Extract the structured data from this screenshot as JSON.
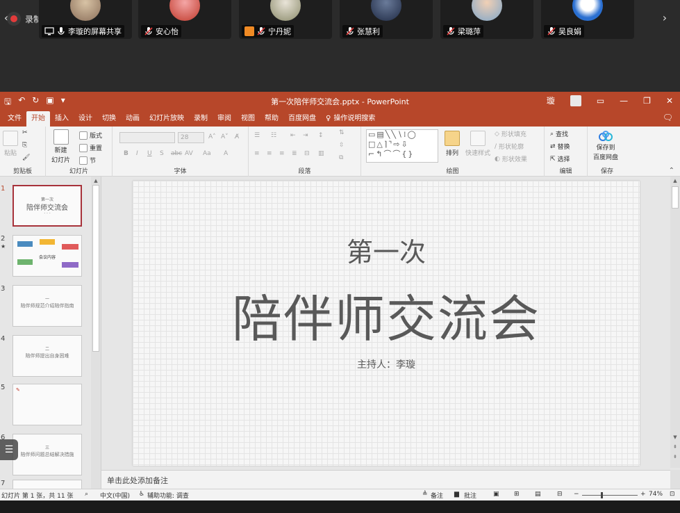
{
  "meeting": {
    "recording_label": "录制中",
    "participants": [
      {
        "name": "李璇的屏幕共享"
      },
      {
        "name": "安心怡"
      },
      {
        "name": "宁丹妮"
      },
      {
        "name": "张慧利"
      },
      {
        "name": "梁璐萍"
      },
      {
        "name": "吴良娟"
      }
    ]
  },
  "ppt": {
    "document_title": "第一次陪伴师交流会.pptx  -  PowerPoint",
    "user_initial": "璇",
    "tabs": [
      "文件",
      "开始",
      "插入",
      "设计",
      "切换",
      "动画",
      "幻灯片放映",
      "录制",
      "审阅",
      "视图",
      "帮助",
      "百度网盘"
    ],
    "active_tab": "开始",
    "tell_me": "操作说明搜索",
    "ribbon": {
      "clipboard": {
        "label": "剪贴板",
        "paste": "粘贴"
      },
      "slides": {
        "label": "幻灯片",
        "new_slide": "新建",
        "new_slide2": "幻灯片",
        "layout": "版式",
        "reset": "重置",
        "section": "节"
      },
      "font": {
        "label": "字体",
        "font_size": "28",
        "bold": "B",
        "italic": "I",
        "underline": "U",
        "strike": "S",
        "abc": "abc",
        "av": "AV",
        "aa": "Aa",
        "a_color": "A"
      },
      "paragraph": {
        "label": "段落"
      },
      "drawing": {
        "label": "绘图",
        "arrange": "排列",
        "quick_styles": "快速样式",
        "shape_fill": "形状填充",
        "shape_outline": "形状轮廓",
        "shape_effects": "形状效果"
      },
      "editing": {
        "label": "编辑",
        "find": "查找",
        "replace": "替换",
        "select": "选择"
      },
      "save": {
        "label": "保存",
        "save_to": "保存到",
        "baidu": "百度网盘"
      }
    }
  },
  "thumbnails": [
    {
      "num": "1",
      "line1": "第一次",
      "line2": "陪伴师交流会",
      "line3": "· · ·"
    },
    {
      "num": "2",
      "star": "★",
      "center": "会议内容"
    },
    {
      "num": "3",
      "line1": "一",
      "line3": "陪伴师规范介绍陪伴指南"
    },
    {
      "num": "4",
      "line1": "二",
      "line3": "陪伴师提出自身困难"
    },
    {
      "num": "5"
    },
    {
      "num": "6",
      "line1": "三",
      "line3": "陪伴师问题总结解决措施"
    },
    {
      "num": "7"
    }
  ],
  "slide": {
    "subtitle": "第一次",
    "title": "陪伴师交流会",
    "host": "主持人：李璇"
  },
  "notes_placeholder": "单击此处添加备注",
  "status": {
    "slide_info": "幻灯片 第 1 张，共 11 张",
    "language": "中文(中国)",
    "accessibility": "辅助功能: 调查",
    "notes": "备注",
    "comments": "批注",
    "zoom": "74%"
  },
  "colors": {
    "ppt_accent": "#b7472a",
    "recording_dot": "#e23b3b"
  }
}
